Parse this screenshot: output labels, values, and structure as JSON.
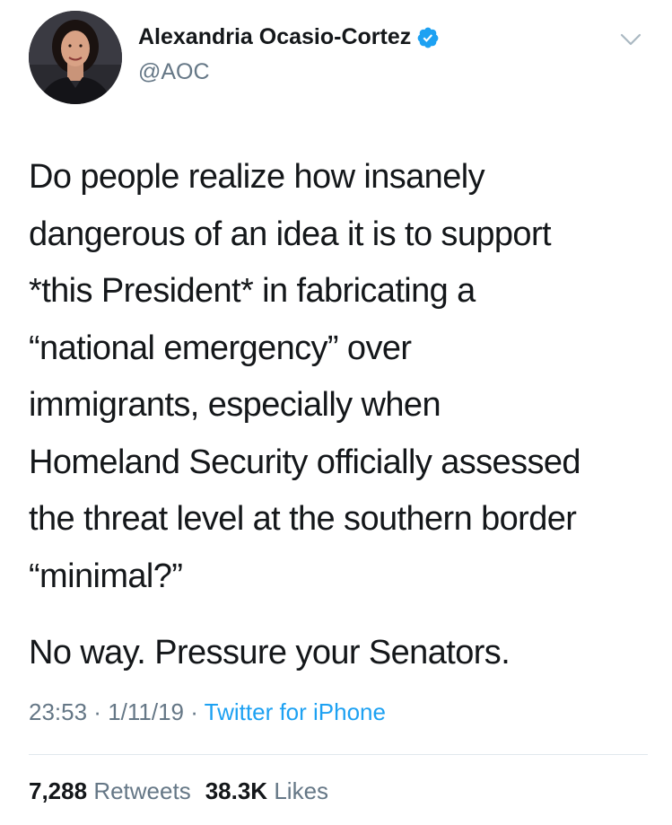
{
  "author": {
    "name": "Alexandria Ocasio-Cortez",
    "handle": "@AOC",
    "verified": true
  },
  "tweet": {
    "paragraphs": [
      "Do people realize how insanely\ndangerous of an idea it is to support\n*this President* in fabricating a\n“national emergency” over\nimmigrants, especially when\nHomeland Security officially assessed\nthe threat level at the southern border\n“minimal?”",
      "No way. Pressure your Senators."
    ]
  },
  "meta": {
    "time": "23:53",
    "separator": " · ",
    "date": "1/11/19",
    "source": "Twitter for iPhone"
  },
  "stats": {
    "retweets_count": "7,288",
    "retweets_label": "Retweets",
    "likes_count": "38.3K",
    "likes_label": "Likes"
  },
  "colors": {
    "accent": "#1da1f2",
    "secondary_text": "#657786",
    "primary_text": "#14171a"
  },
  "icons": {
    "verified": "verified-badge-icon",
    "menu": "chevron-down-icon"
  }
}
